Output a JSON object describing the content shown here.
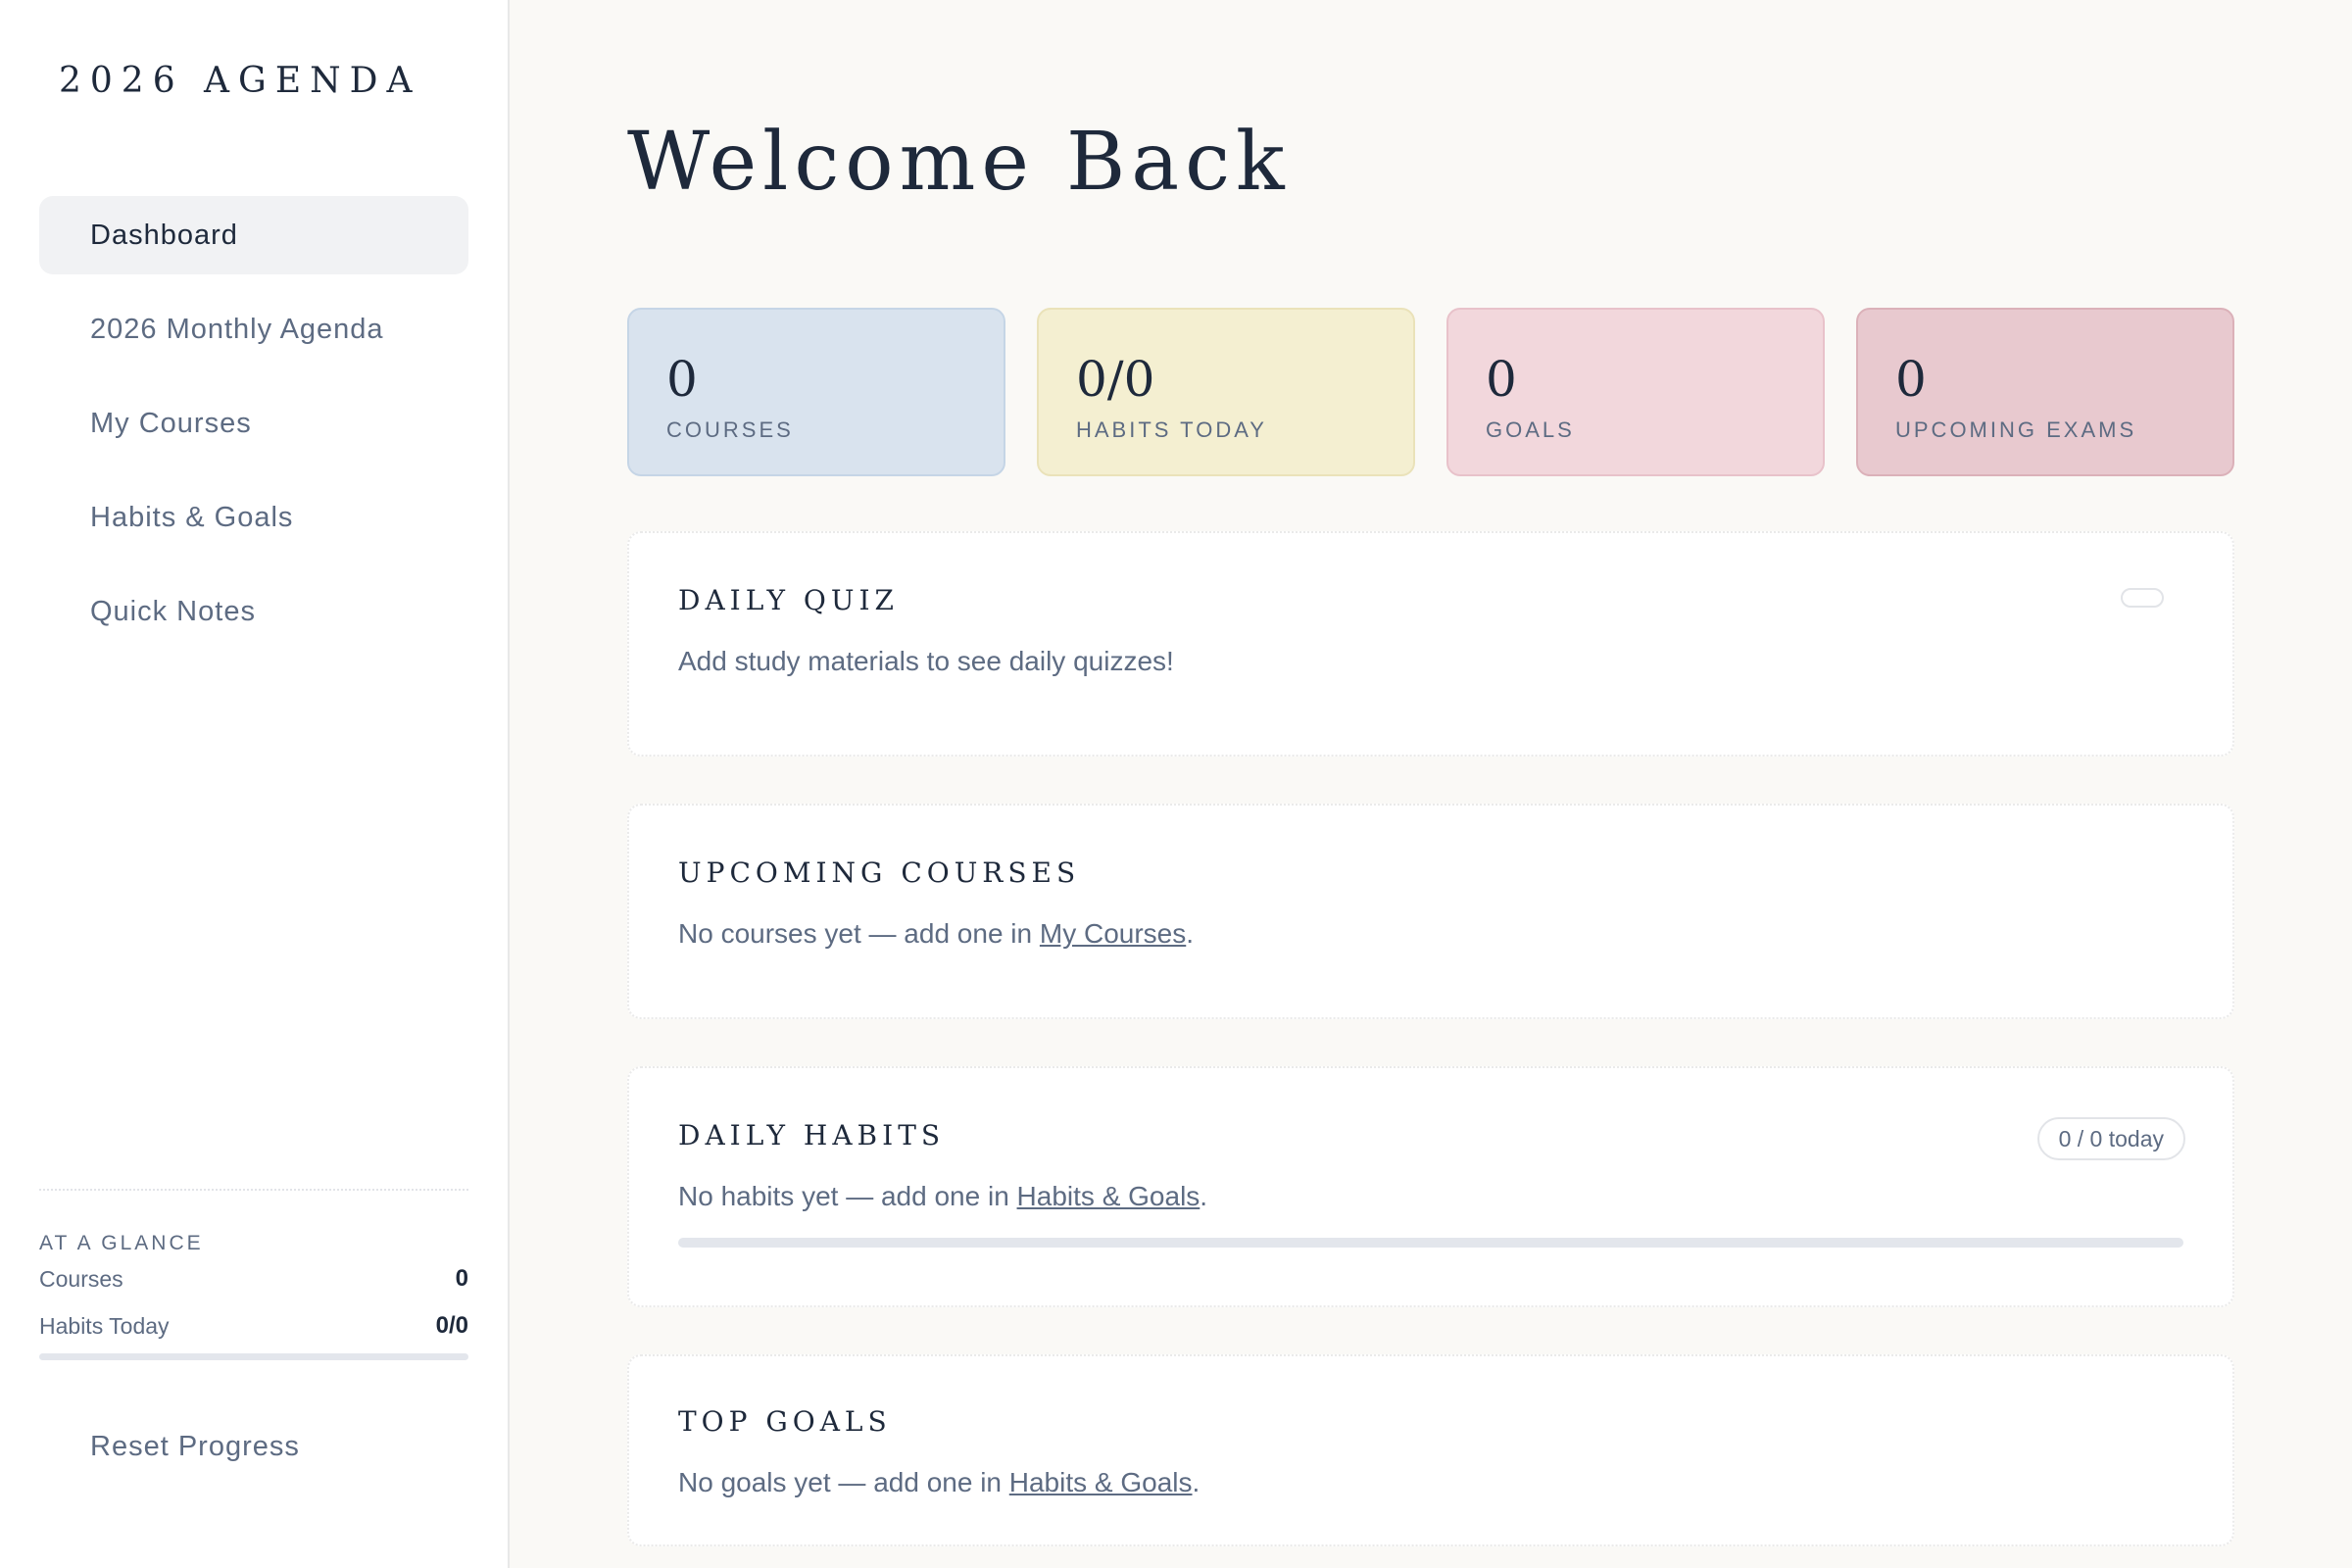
{
  "brand": "2026 AGENDA",
  "nav": {
    "items": [
      {
        "label": "Dashboard",
        "active": true
      },
      {
        "label": "2026 Monthly Agenda",
        "active": false
      },
      {
        "label": "My Courses",
        "active": false
      },
      {
        "label": "Habits & Goals",
        "active": false
      },
      {
        "label": "Quick Notes",
        "active": false
      }
    ]
  },
  "glance": {
    "title": "AT A GLANCE",
    "courses_label": "Courses",
    "courses_value": "0",
    "habits_label": "Habits Today",
    "habits_value": "0/0",
    "habits_progress": 0
  },
  "reset_label": "Reset Progress",
  "page_title": "Welcome Back",
  "stats": [
    {
      "value": "0",
      "label": "COURSES",
      "color": "#d9e3ee"
    },
    {
      "value": "0/0",
      "label": "HABITS TODAY",
      "color": "#f4efd1"
    },
    {
      "value": "0",
      "label": "GOALS",
      "color": "#f2d7dc"
    },
    {
      "value": "0",
      "label": "UPCOMING EXAMS",
      "color": "#e8c9cf"
    }
  ],
  "quiz": {
    "title": "DAILY QUIZ",
    "text": "Add study materials to see daily quizzes!"
  },
  "courses": {
    "title": "UPCOMING COURSES",
    "text_before": "No courses yet — add one in ",
    "link": "My Courses",
    "text_after": "."
  },
  "habits": {
    "title": "DAILY HABITS",
    "badge": "0 / 0 today",
    "text_before": "No habits yet — add one in ",
    "link": "Habits & Goals",
    "text_after": ".",
    "progress": 0
  },
  "goals": {
    "title": "TOP GOALS",
    "text_before": "No goals yet — add one in ",
    "link": "Habits & Goals",
    "text_after": "."
  },
  "colors": {
    "background": "#faf9f6",
    "text_primary": "#1e293b",
    "text_muted": "#5d6b82"
  }
}
